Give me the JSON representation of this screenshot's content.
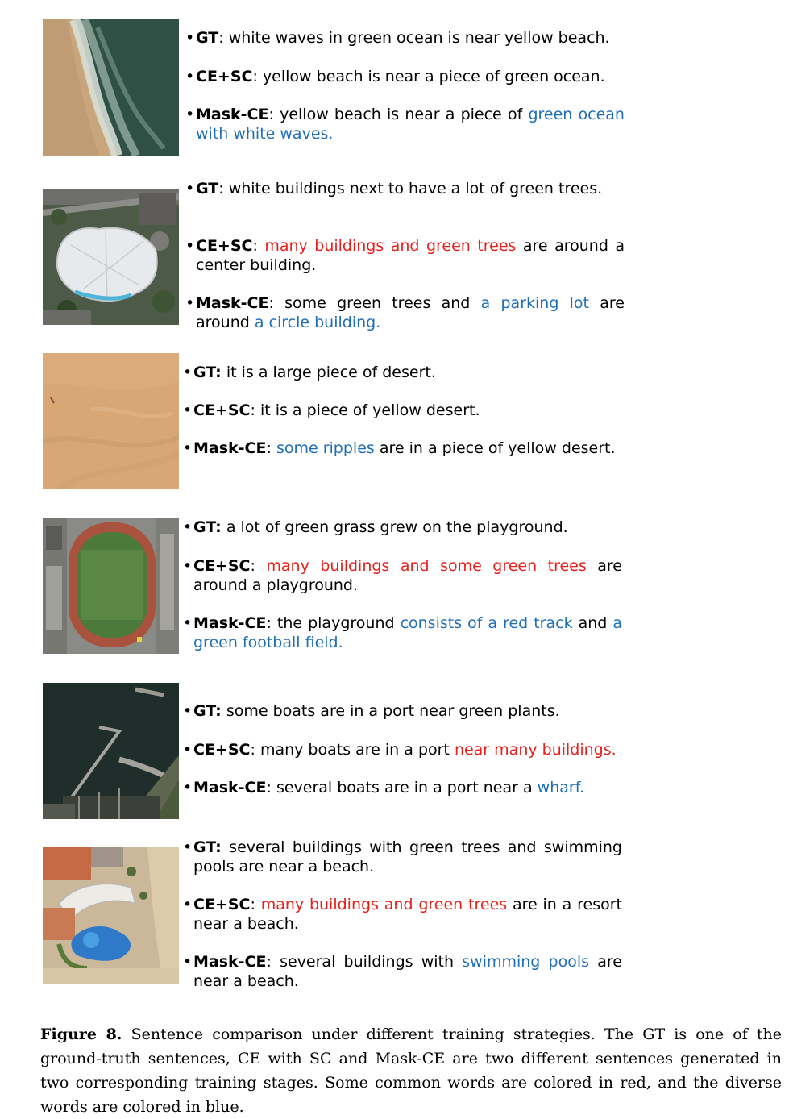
{
  "rows": [
    {
      "image": "beach-ocean-aerial",
      "lines": [
        {
          "label": "GT",
          "colon": ": ",
          "parts": [
            {
              "t": "white waves in green ocean is near yellow beach.",
              "c": ""
            }
          ]
        },
        {
          "label": "CE+SC",
          "colon": ": ",
          "parts": [
            {
              "t": "yellow beach is near a piece of green ocean.",
              "c": ""
            }
          ]
        },
        {
          "label": "Mask-CE",
          "colon": ": ",
          "parts": [
            {
              "t": "yellow beach is near a piece of ",
              "c": ""
            },
            {
              "t": "green ocean with white waves.",
              "c": "blue"
            }
          ]
        }
      ]
    },
    {
      "image": "center-building-aerial",
      "lines": [
        {
          "label": "GT",
          "colon": ": ",
          "parts": [
            {
              "t": "white buildings next to have a lot of green trees.",
              "c": ""
            }
          ]
        },
        {
          "label": "CE+SC",
          "colon": ": ",
          "parts": [
            {
              "t": "many buildings and green trees",
              "c": "red"
            },
            {
              "t": " are around a center building.",
              "c": ""
            }
          ]
        },
        {
          "label": "Mask-CE",
          "colon": ": ",
          "parts": [
            {
              "t": "some green trees and ",
              "c": ""
            },
            {
              "t": "a parking lot",
              "c": "blue"
            },
            {
              "t": " are around ",
              "c": ""
            },
            {
              "t": "a circle building.",
              "c": "blue"
            }
          ]
        }
      ]
    },
    {
      "image": "desert-aerial",
      "lines": [
        {
          "label": "GT:",
          "colon": " ",
          "parts": [
            {
              "t": "it is a large piece of desert.",
              "c": ""
            }
          ]
        },
        {
          "label": "CE+SC",
          "colon": ": ",
          "parts": [
            {
              "t": "it is a piece of yellow desert.",
              "c": ""
            }
          ]
        },
        {
          "label": "Mask-CE",
          "colon": ": ",
          "parts": [
            {
              "t": "some ripples",
              "c": "blue"
            },
            {
              "t": " are in a piece of yellow desert.",
              "c": ""
            }
          ]
        }
      ]
    },
    {
      "image": "playground-aerial",
      "lines": [
        {
          "label": "GT:",
          "colon": " ",
          "parts": [
            {
              "t": "a lot of green grass grew on the playground.",
              "c": ""
            }
          ]
        },
        {
          "label": "CE+SC",
          "colon": ": ",
          "parts": [
            {
              "t": "many buildings and some green trees",
              "c": "red"
            },
            {
              "t": " are around a playground.",
              "c": ""
            }
          ]
        },
        {
          "label": "Mask-CE",
          "colon": ": ",
          "parts": [
            {
              "t": "the playground ",
              "c": ""
            },
            {
              "t": "consists of a red track",
              "c": "blue"
            },
            {
              "t": " and ",
              "c": ""
            },
            {
              "t": "a green football field.",
              "c": "blue"
            }
          ]
        }
      ]
    },
    {
      "image": "port-aerial",
      "lines": [
        {
          "label": "GT:",
          "colon": " ",
          "parts": [
            {
              "t": "some boats are in a port near green plants.",
              "c": ""
            }
          ]
        },
        {
          "label": "CE+SC",
          "colon": ": ",
          "parts": [
            {
              "t": "many boats are in a port ",
              "c": ""
            },
            {
              "t": "near many buildings.",
              "c": "red"
            }
          ]
        },
        {
          "label": "Mask-CE",
          "colon": ": ",
          "parts": [
            {
              "t": "several boats are in a port near a ",
              "c": ""
            },
            {
              "t": "wharf.",
              "c": "blue"
            }
          ]
        }
      ]
    },
    {
      "image": "resort-aerial",
      "lines": [
        {
          "label": "GT:",
          "colon": " ",
          "parts": [
            {
              "t": "several buildings with green trees and swimming pools are near a beach.",
              "c": ""
            }
          ]
        },
        {
          "label": "CE+SC",
          "colon": ": ",
          "parts": [
            {
              "t": "many buildings and green trees",
              "c": "red"
            },
            {
              "t": " are in a resort near a beach.",
              "c": ""
            }
          ]
        },
        {
          "label": "Mask-CE",
          "colon": ": ",
          "parts": [
            {
              "t": "several buildings with ",
              "c": ""
            },
            {
              "t": "swimming pools",
              "c": "blue"
            },
            {
              "t": " are near a beach.",
              "c": ""
            }
          ]
        }
      ]
    }
  ],
  "caption": {
    "figure_label": "Figure 8.",
    "text": " Sentence comparison under different training strategies. The GT is one of the ground-truth sentences, CE with SC and Mask-CE are two different sentences generated in two corresponding training stages. Some common words are colored in red, and the diverse words are colored in blue."
  }
}
